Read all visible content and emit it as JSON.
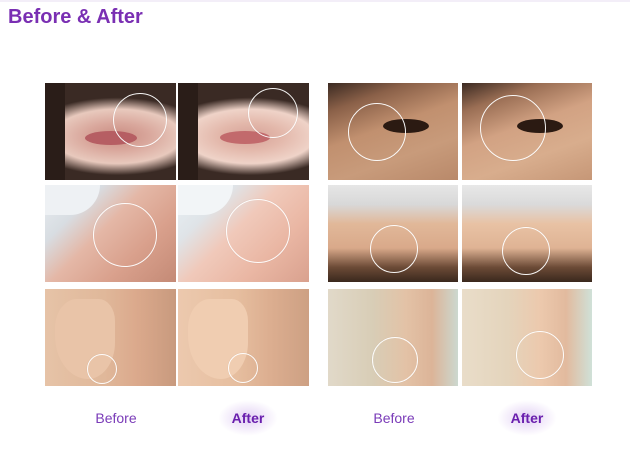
{
  "page": {
    "title": "Before & After"
  },
  "captions": {
    "left_before": "Before",
    "left_after": "After",
    "right_before": "Before",
    "right_after": "After"
  },
  "colors": {
    "title": "#7a2fb3",
    "before_label": "#7a3bb8",
    "after_label": "#6a1fae"
  },
  "photos": [
    {
      "name": "photo-lips-before",
      "subject": "smile lines",
      "state": "before"
    },
    {
      "name": "photo-lips-after",
      "subject": "smile lines",
      "state": "after"
    },
    {
      "name": "photo-cheek-before",
      "subject": "cheek pores",
      "state": "before"
    },
    {
      "name": "photo-cheek-after",
      "subject": "cheek pores",
      "state": "after"
    },
    {
      "name": "photo-chin-before",
      "subject": "double chin",
      "state": "before"
    },
    {
      "name": "photo-chin-after",
      "subject": "double chin",
      "state": "after"
    },
    {
      "name": "photo-eye-before",
      "subject": "crow's feet",
      "state": "before"
    },
    {
      "name": "photo-eye-after",
      "subject": "crow's feet",
      "state": "after"
    },
    {
      "name": "photo-forehead-before",
      "subject": "forehead wrinkles",
      "state": "before"
    },
    {
      "name": "photo-forehead-after",
      "subject": "forehead wrinkles",
      "state": "after"
    },
    {
      "name": "photo-neck-before",
      "subject": "jawline",
      "state": "before"
    },
    {
      "name": "photo-neck-after",
      "subject": "jawline",
      "state": "after"
    }
  ]
}
